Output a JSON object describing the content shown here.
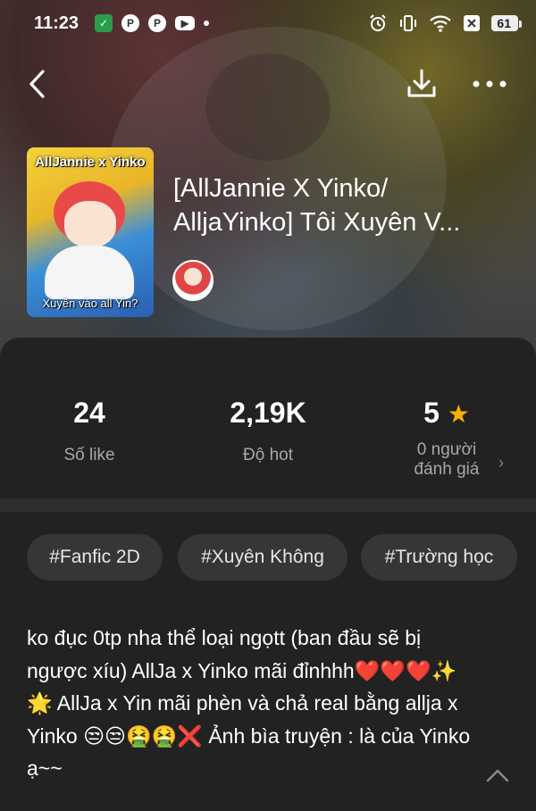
{
  "status_bar": {
    "time": "11:23",
    "battery": "61",
    "left_icons": [
      "shield-icon",
      "pinterest-icon",
      "pinterest-icon",
      "youtube-icon",
      "dot-icon"
    ],
    "right_icons": [
      "alarm-icon",
      "vibrate-icon",
      "wifi-icon",
      "close-box-icon",
      "battery-icon"
    ]
  },
  "story": {
    "title": "[AllJannie X Yinko/ AlljaYinko] Tôi Xuyên V...",
    "cover_title": "AllJannie x Yinko",
    "cover_subtitle": "Xuyên vào all Yin?"
  },
  "stats": {
    "likes_value": "24",
    "likes_label": "Số like",
    "hot_value": "2,19K",
    "hot_label": "Độ hot",
    "rating_value": "5",
    "rating_label": "0 người đánh giá"
  },
  "tags": [
    "#Fanfic 2D",
    "#Xuyên Không",
    "#Trường học"
  ],
  "description": "ko đục 0tp nha thể loại ngọtt (ban đầu sẽ bị ngược xíu) AllJa x Yinko mãi đỉnhhh❤️❤️❤️✨🌟 AllJa x Yin mãi phèn và chả real bằng allja x Yinko 😒😒🤮🤮❌ Ảnh bìa truyện : là của Yinko ạ~~",
  "colors": {
    "background": "#222222",
    "star": "#f4b400",
    "tag_bg": "#363636",
    "muted_text": "#a8a8a8"
  }
}
